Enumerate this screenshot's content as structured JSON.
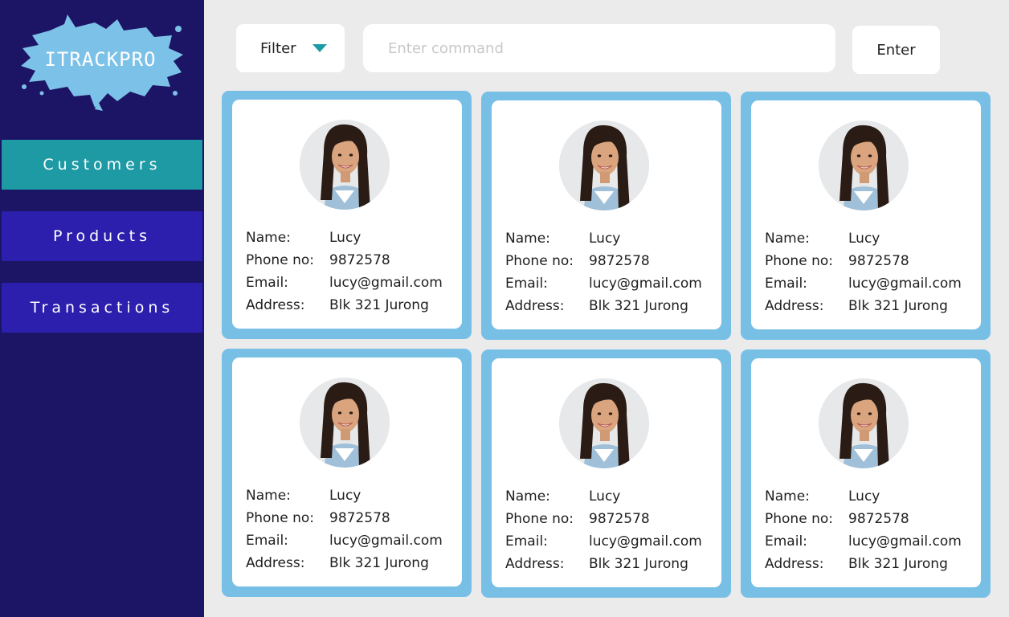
{
  "app": {
    "logo_text": "iTrackPro"
  },
  "sidebar": {
    "items": [
      {
        "label": "Customers"
      },
      {
        "label": "Products"
      },
      {
        "label": "Transactions"
      }
    ]
  },
  "toolbar": {
    "filter_label": "Filter",
    "command_placeholder": "Enter command",
    "command_value": "",
    "enter_label": "Enter"
  },
  "labels": {
    "name": "Name:",
    "phone": "Phone no:",
    "email": "Email:",
    "address": "Address:"
  },
  "customers": [
    {
      "name": "Lucy",
      "phone": "9872578",
      "email": "lucy@gmail.com",
      "address": "Blk 321 Jurong"
    },
    {
      "name": "Lucy",
      "phone": "9872578",
      "email": "lucy@gmail.com",
      "address": "Blk 321 Jurong"
    },
    {
      "name": "Lucy",
      "phone": "9872578",
      "email": "lucy@gmail.com",
      "address": "Blk 321 Jurong"
    },
    {
      "name": "Lucy",
      "phone": "9872578",
      "email": "lucy@gmail.com",
      "address": "Blk 321 Jurong"
    },
    {
      "name": "Lucy",
      "phone": "9872578",
      "email": "lucy@gmail.com",
      "address": "Blk 321 Jurong"
    },
    {
      "name": "Lucy",
      "phone": "9872578",
      "email": "lucy@gmail.com",
      "address": "Blk 321 Jurong"
    }
  ],
  "colors": {
    "sidebar_bg": "#1c1464",
    "active_nav": "#1e9aa4",
    "nav": "#2c1fad",
    "card_frame": "#78bfe6",
    "logo_splash": "#7cc1e8"
  },
  "icons": {
    "filter_caret": "caret-down-icon"
  }
}
